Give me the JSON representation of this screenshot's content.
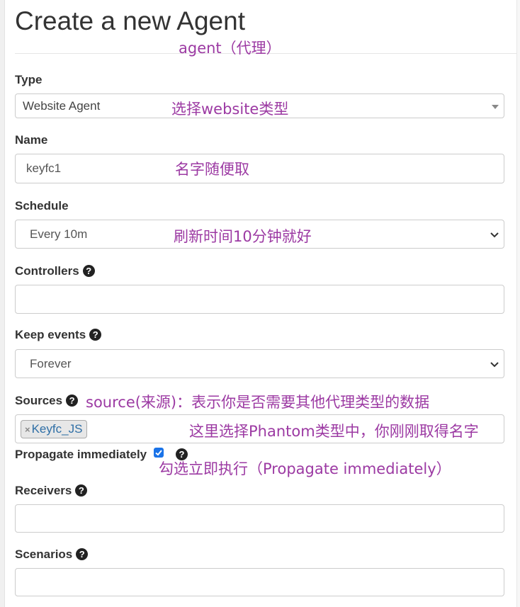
{
  "page": {
    "title": "Create a new Agent"
  },
  "form": {
    "type": {
      "label": "Type",
      "value": "Website Agent"
    },
    "name": {
      "label": "Name",
      "value": "keyfc1"
    },
    "schedule": {
      "label": "Schedule",
      "value": "Every 10m"
    },
    "controllers": {
      "label": "Controllers",
      "value": ""
    },
    "keep_events": {
      "label": "Keep events",
      "value": "Forever"
    },
    "sources": {
      "label": "Sources",
      "tags": [
        "Keyfc_JS"
      ],
      "tag_remove": "×"
    },
    "propagate": {
      "label": "Propagate immediately",
      "checked": true
    },
    "receivers": {
      "label": "Receivers",
      "value": ""
    },
    "scenarios": {
      "label": "Scenarios",
      "value": ""
    },
    "help_glyph": "?"
  },
  "annotations": {
    "agent": "agent（代理）",
    "type": "选择website类型",
    "name": "名字随便取",
    "schedule": "刷新时间10分钟就好",
    "sources": "source(来源)：表示你是否需要其他代理类型的数据",
    "sources_hint": "这里选择Phantom类型中，你刚刚取得名字",
    "propagate": "勾选立即执行（Propagate immediately）"
  },
  "colors": {
    "annotation": "#9c3aa3",
    "tag_text": "#2f6fa6",
    "checkbox": "#1a73e8"
  },
  "icons": {
    "help": "question-circle-icon",
    "select_caret": "caret-down-icon",
    "select_chevron": "chevron-down-icon",
    "tag_remove": "close-icon",
    "checkbox": "check-icon"
  }
}
